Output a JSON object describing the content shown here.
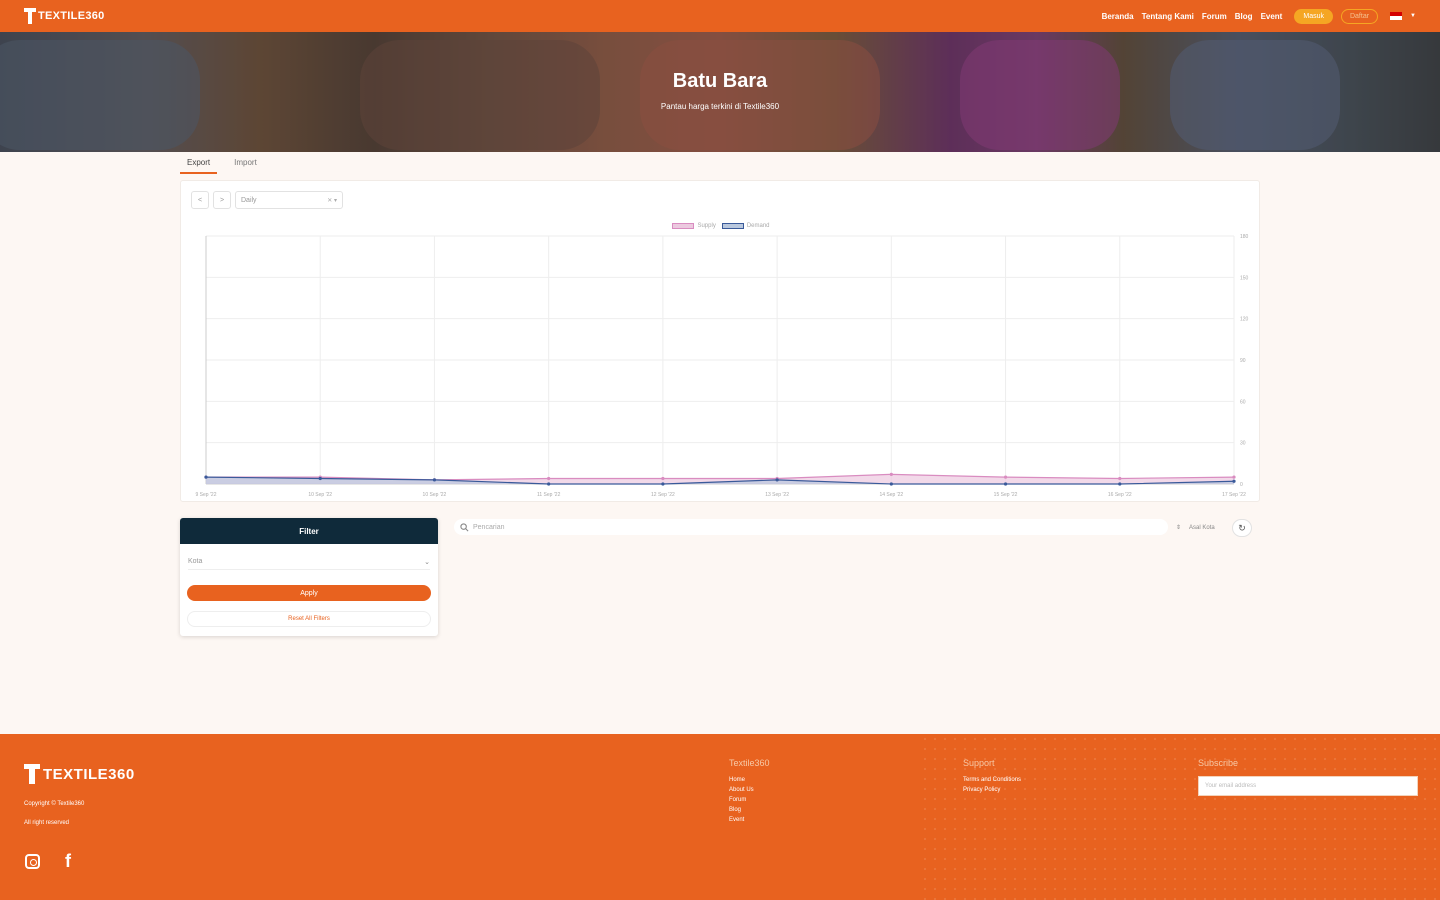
{
  "nav": {
    "brand": "TEXTILE360",
    "links": [
      "Beranda",
      "Tentang Kami",
      "Forum",
      "Blog",
      "Event"
    ],
    "login": "Masuk",
    "register": "Daftar"
  },
  "hero": {
    "title": "Batu Bara",
    "subtitle": "Pantau harga terkini di Textile360"
  },
  "tabs": [
    "Export",
    "Import"
  ],
  "controls": {
    "prev": "<",
    "next": ">",
    "period": "Daily"
  },
  "chart_data": {
    "type": "area",
    "series": [
      {
        "name": "Supply",
        "color": "#d98cc0",
        "fill": "#ecc9df",
        "values": [
          5,
          5,
          3,
          4,
          4,
          4,
          7,
          5,
          4,
          5
        ]
      },
      {
        "name": "Demand",
        "color": "#3a5a9a",
        "fill": "#b9c8de",
        "values": [
          5,
          4,
          3,
          0,
          0,
          3,
          0,
          0,
          0,
          2
        ]
      }
    ],
    "x_tick_labels": [
      "9 Sep '22",
      "10 Sep '22",
      "10 Sep '22",
      "11 Sep '22",
      "12 Sep '22",
      "13 Sep '22",
      "14 Sep '22",
      "15 Sep '22",
      "16 Sep '22",
      "17 Sep '22"
    ],
    "y_ticks": [
      0,
      30,
      60,
      90,
      120,
      150,
      180
    ],
    "ylim": [
      0,
      180
    ],
    "grid": true,
    "legend": "top"
  },
  "filter": {
    "title": "Filter",
    "select_placeholder": "Kota",
    "apply": "Apply",
    "reset": "Reset All Filters"
  },
  "search": {
    "placeholder": "Pencarian",
    "sort_label": "Asal Kota"
  },
  "footer": {
    "brand": "TEXTILE360",
    "copyright": "Copyright © Textile360",
    "rights": "All right reserved",
    "columns": [
      {
        "title": "Textile360",
        "links": [
          "Home",
          "About Us",
          "Forum",
          "Blog",
          "Event"
        ]
      },
      {
        "title": "Support",
        "links": [
          "Terms and Conditions",
          "Privacy Policy"
        ]
      }
    ],
    "subscribe_title": "Subscribe",
    "subscribe_placeholder": "Your email address"
  }
}
